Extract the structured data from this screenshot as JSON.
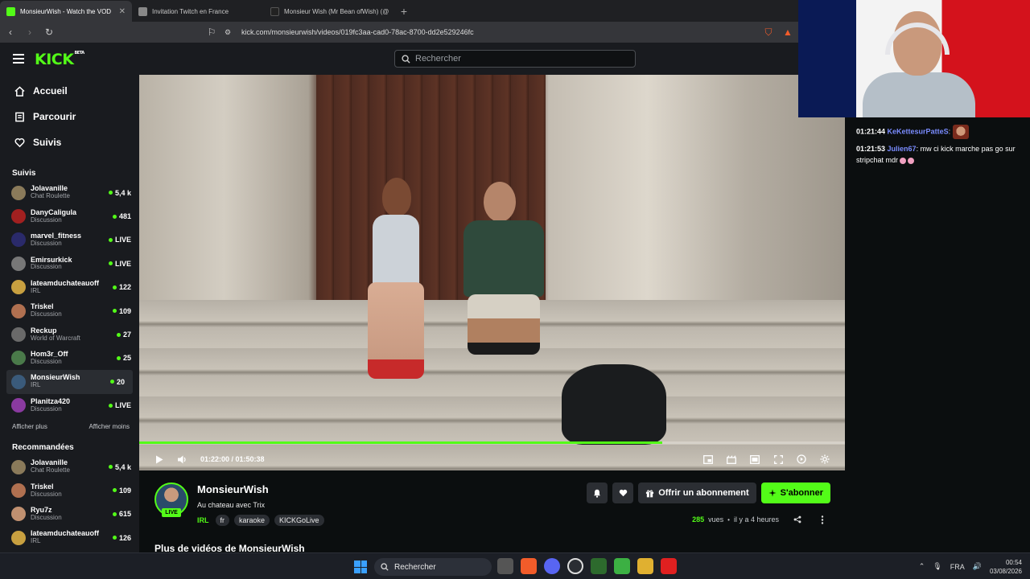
{
  "browser": {
    "tabs": [
      {
        "title": "MonsieurWish - Watch the VOD",
        "active": true,
        "favicon_color": "#53fc18"
      },
      {
        "title": "Invitation Twitch en France",
        "active": false,
        "favicon_color": "#888888"
      },
      {
        "title": "Monsieur Wish (Mr Bean ofWish) (@",
        "active": false,
        "favicon_color": "#222222"
      }
    ],
    "url": "kick.com/monsieurwish/videos/019fc3aa-cad0-78ac-8700-dd2e529246fc"
  },
  "header": {
    "logo": "KICK",
    "logo_badge": "BETA",
    "search_placeholder": "Rechercher"
  },
  "sidebar": {
    "nav": [
      {
        "label": "Accueil",
        "icon": "home-icon"
      },
      {
        "label": "Parcourir",
        "icon": "browse-icon"
      },
      {
        "label": "Suivis",
        "icon": "heart-icon"
      }
    ],
    "followed_title": "Suivis",
    "followed": [
      {
        "name": "Jolavanille",
        "category": "Chat Roulette",
        "viewers": "5,4 k",
        "color": "#8a7a5a"
      },
      {
        "name": "DanyCaligula",
        "category": "Discussion",
        "viewers": "481",
        "color": "#a12020"
      },
      {
        "name": "marvel_fitness",
        "category": "Discussion",
        "viewers": "LIVE",
        "color": "#2a2a6a"
      },
      {
        "name": "Emirsurkick",
        "category": "Discussion",
        "viewers": "LIVE",
        "color": "#777777"
      },
      {
        "name": "lateamduchateauoff",
        "category": "IRL",
        "viewers": "122",
        "color": "#c8a040"
      },
      {
        "name": "Triskel",
        "category": "Discussion",
        "viewers": "109",
        "color": "#b07050"
      },
      {
        "name": "Reckup",
        "category": "World of Warcraft",
        "viewers": "27",
        "color": "#6a6a6a"
      },
      {
        "name": "Hom3r_Off",
        "category": "Discussion",
        "viewers": "25",
        "color": "#4a7a4a"
      },
      {
        "name": "MonsieurWish",
        "category": "IRL",
        "viewers": "20",
        "color": "#3a5a7a",
        "active": true
      },
      {
        "name": "Planitza420",
        "category": "Discussion",
        "viewers": "LIVE",
        "color": "#8a3aa0"
      }
    ],
    "show_more": "Afficher plus",
    "show_less": "Afficher moins",
    "recommended_title": "Recommandées",
    "recommended": [
      {
        "name": "Jolavanille",
        "category": "Chat Roulette",
        "viewers": "5,4 k",
        "color": "#8a7a5a"
      },
      {
        "name": "Triskel",
        "category": "Discussion",
        "viewers": "109",
        "color": "#b07050"
      },
      {
        "name": "Ryu7z",
        "category": "Discussion",
        "viewers": "615",
        "color": "#c09070"
      },
      {
        "name": "lateamduchateauoff",
        "category": "IRL",
        "viewers": "126",
        "color": "#c8a040"
      }
    ]
  },
  "player": {
    "current_time": "01:22:00",
    "duration": "01:50:38",
    "time_display": "01:22:00 / 01:50:38",
    "progress": 0.741
  },
  "video_info": {
    "channel": "MonsieurWish",
    "live_badge": "LIVE",
    "title": "Au chateau avec Trix",
    "category": "IRL",
    "tags": [
      "fr",
      "karaoke",
      "KICKGoLive"
    ],
    "gift_label": "Offrir un abonnement",
    "subscribe_label": "S'abonner",
    "views_count": "285",
    "views_label": "vues",
    "age": "il y a 4 heures",
    "more_videos_title": "Plus de vidéos de MonsieurWish"
  },
  "chat": {
    "messages": [
      {
        "time": "01:21:44",
        "user": "KeKettesurPatteS",
        "user_color": "#7a8cff",
        "text": "",
        "has_emote": true
      },
      {
        "time": "01:21:53",
        "user": "Julien67",
        "user_color": "#7a8cff",
        "text": "mw ci kick marche pas go sur stripchat mdr",
        "has_emote": false
      }
    ]
  },
  "taskbar": {
    "search_label": "Rechercher",
    "lang": "FRA",
    "time": "00:54",
    "date": "03/08/2026"
  },
  "colors": {
    "accent": "#53fc18",
    "sidebar_bg": "#191b1f",
    "page_bg": "#0b0e0f"
  }
}
